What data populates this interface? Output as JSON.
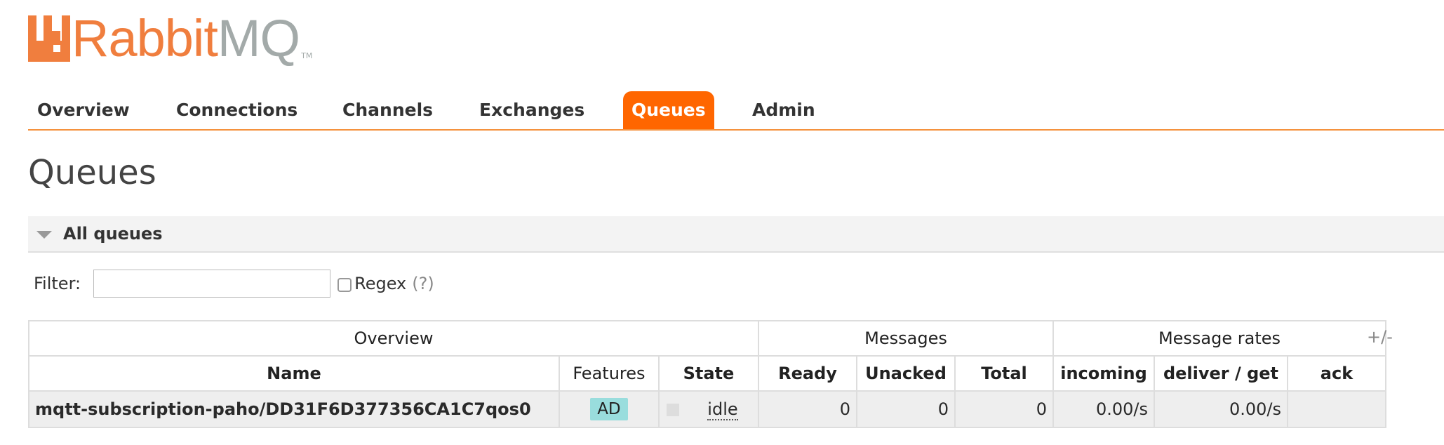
{
  "logo": {
    "text_rabbit": "Rabbit",
    "text_mq": "MQ",
    "tm": "TM",
    "icon": "rabbitmq-logo-icon"
  },
  "nav": {
    "items": [
      {
        "label": "Overview"
      },
      {
        "label": "Connections"
      },
      {
        "label": "Channels"
      },
      {
        "label": "Exchanges"
      },
      {
        "label": "Queues",
        "active": true
      },
      {
        "label": "Admin"
      }
    ]
  },
  "page": {
    "title": "Queues"
  },
  "section": {
    "title": "All queues",
    "icon": "collapse-triangle-icon"
  },
  "filter": {
    "label": "Filter:",
    "value": "",
    "placeholder": "",
    "regex_label": "Regex",
    "regex_checked": false,
    "help": "(?)"
  },
  "table": {
    "groups": [
      "Overview",
      "Messages",
      "Message rates"
    ],
    "columns": [
      "Name",
      "Features",
      "State",
      "Ready",
      "Unacked",
      "Total",
      "incoming",
      "deliver / get",
      "ack"
    ],
    "rows": [
      {
        "name": "mqtt-subscription-paho/DD31F6D377356CA1C7qos0",
        "features": "AD",
        "state": "idle",
        "ready": "0",
        "unacked": "0",
        "total": "0",
        "incoming": "0.00/s",
        "deliver_get": "0.00/s",
        "ack": ""
      }
    ],
    "toggle_columns": "+/-"
  },
  "colors": {
    "accent": "#ff6600",
    "nav_underline": "#f5923e",
    "logo_orange": "#f07e3e",
    "logo_grey": "#a3aaa9",
    "feature_badge": "#99dddd"
  }
}
